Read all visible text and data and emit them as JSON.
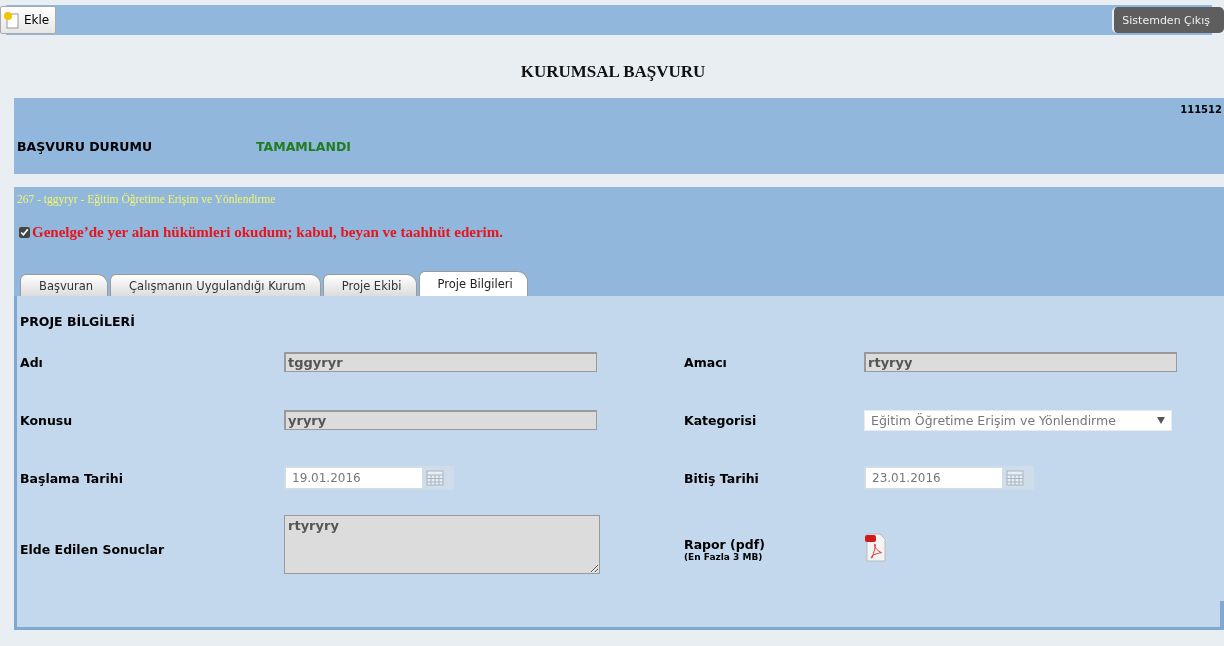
{
  "toolbar": {
    "add_button": "Ekle",
    "logout_button": "Sistemden Çıkış"
  },
  "header": {
    "title": "KURUMSAL BAŞVURU"
  },
  "status": {
    "number": "111512",
    "label": "BAŞVURU DURUMU",
    "value": "TAMAMLANDI"
  },
  "project": {
    "summary": "267 - tggyryr - Eğitim Öğretime Erişim ve Yönlendirme",
    "agreement": {
      "text": "Genelge’de yer alan hükümleri okudum; kabul, beyan ve taahhüt ederim.",
      "checked": true
    }
  },
  "tabs": [
    {
      "label": "Başvuran",
      "selected": false
    },
    {
      "label": "Çalışmanın Uygulandığı Kurum",
      "selected": false
    },
    {
      "label": "Proje Ekibi",
      "selected": false
    },
    {
      "label": "Proje Bilgileri",
      "selected": true
    }
  ],
  "form": {
    "heading": "PROJE BİLGİLERİ",
    "fields": [
      {
        "kind": "text",
        "label": "Adı",
        "value": "tggyryr"
      },
      {
        "kind": "text",
        "label": "Amacı",
        "value": "rtyryy"
      },
      {
        "kind": "text",
        "label": "Konusu",
        "value": "yryry"
      },
      {
        "kind": "select",
        "label": "Kategorisi",
        "value": "Eğitim Öğretime Erişim ve Yönlendirme"
      },
      {
        "kind": "date",
        "label": "Başlama Tarihi",
        "value": "19.01.2016"
      },
      {
        "kind": "date",
        "label": "Bitiş Tarihi",
        "value": "23.01.2016"
      },
      {
        "kind": "textarea",
        "label": "Elde Edilen Sonuclar",
        "value": "rtyryry"
      },
      {
        "kind": "file",
        "label": "Rapor (pdf)",
        "note": "(En Fazla 3 MB)"
      }
    ]
  }
}
